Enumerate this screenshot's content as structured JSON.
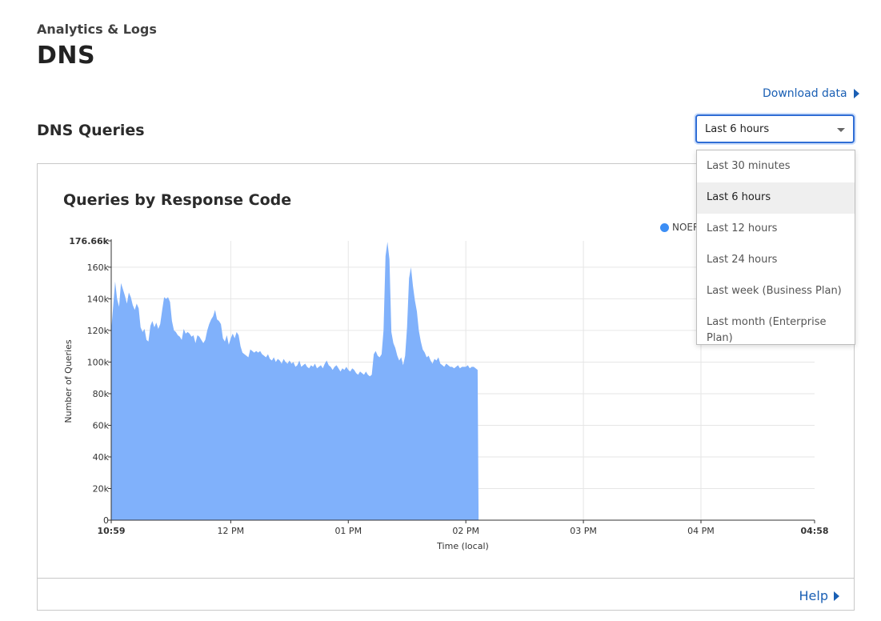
{
  "header": {
    "breadcrumb": "Analytics & Logs",
    "title": "DNS"
  },
  "download_label": "Download data",
  "section_title": "DNS Queries",
  "time_select": {
    "value": "Last 6 hours",
    "options": [
      "Last 30 minutes",
      "Last 6 hours",
      "Last 12 hours",
      "Last 24 hours",
      "Last week (Business Plan)",
      "Last month (Enterprise Plan)"
    ],
    "selected_index": 1
  },
  "chart_title": "Queries by Response Code",
  "legend_label": "NOER",
  "help_label": "Help",
  "colors": {
    "area_fill": "#80b1fb",
    "legend": "#3c8ef5",
    "link": "#1a5fb4",
    "focus": "#2f6dd5"
  },
  "chart_data": {
    "type": "area",
    "title": "Queries by Response Code",
    "xlabel": "Time (local)",
    "ylabel": "Number of Queries",
    "series_name": "NOER",
    "ylim": [
      0,
      176660
    ],
    "y_ticks": [
      "0",
      "20k",
      "40k",
      "60k",
      "80k",
      "100k",
      "120k",
      "140k",
      "160k",
      "176.66k"
    ],
    "x_ticks": [
      "10:59",
      "12 PM",
      "01 PM",
      "02 PM",
      "03 PM",
      "04 PM",
      "04:58"
    ],
    "x_tick_minutes": [
      0,
      61,
      121,
      181,
      241,
      301,
      359
    ],
    "grid": true,
    "legend_position": "top-right",
    "points": [
      [
        0,
        120000
      ],
      [
        1,
        135000
      ],
      [
        2,
        151000
      ],
      [
        3,
        140000
      ],
      [
        4,
        135000
      ],
      [
        5,
        150000
      ],
      [
        6,
        146000
      ],
      [
        7,
        142000
      ],
      [
        8,
        137000
      ],
      [
        9,
        144000
      ],
      [
        10,
        141000
      ],
      [
        11,
        136000
      ],
      [
        12,
        133000
      ],
      [
        13,
        137000
      ],
      [
        14,
        134000
      ],
      [
        15,
        122000
      ],
      [
        16,
        119000
      ],
      [
        17,
        121000
      ],
      [
        18,
        114000
      ],
      [
        19,
        113000
      ],
      [
        20,
        123000
      ],
      [
        21,
        126000
      ],
      [
        22,
        122000
      ],
      [
        23,
        125000
      ],
      [
        24,
        121000
      ],
      [
        25,
        124000
      ],
      [
        26,
        133000
      ],
      [
        27,
        141000
      ],
      [
        28,
        140000
      ],
      [
        29,
        141000
      ],
      [
        30,
        138000
      ],
      [
        31,
        126000
      ],
      [
        32,
        120000
      ],
      [
        33,
        119000
      ],
      [
        34,
        117000
      ],
      [
        35,
        116000
      ],
      [
        36,
        114000
      ],
      [
        37,
        121000
      ],
      [
        38,
        118000
      ],
      [
        39,
        119000
      ],
      [
        40,
        118000
      ],
      [
        41,
        116000
      ],
      [
        42,
        117000
      ],
      [
        43,
        112000
      ],
      [
        44,
        117000
      ],
      [
        45,
        116000
      ],
      [
        46,
        114000
      ],
      [
        47,
        112000
      ],
      [
        48,
        114000
      ],
      [
        49,
        120000
      ],
      [
        50,
        124000
      ],
      [
        51,
        127000
      ],
      [
        52,
        129000
      ],
      [
        53,
        133000
      ],
      [
        54,
        127000
      ],
      [
        55,
        126000
      ],
      [
        56,
        124000
      ],
      [
        57,
        115000
      ],
      [
        58,
        113000
      ],
      [
        59,
        117000
      ],
      [
        60,
        111000
      ],
      [
        61,
        115000
      ],
      [
        62,
        118000
      ],
      [
        63,
        115000
      ],
      [
        64,
        119000
      ],
      [
        65,
        117000
      ],
      [
        66,
        110000
      ],
      [
        67,
        106000
      ],
      [
        68,
        105000
      ],
      [
        69,
        104000
      ],
      [
        70,
        103000
      ],
      [
        71,
        108000
      ],
      [
        72,
        107000
      ],
      [
        73,
        106000
      ],
      [
        74,
        107000
      ],
      [
        75,
        106000
      ],
      [
        76,
        107000
      ],
      [
        77,
        105000
      ],
      [
        78,
        104000
      ],
      [
        79,
        103000
      ],
      [
        80,
        105000
      ],
      [
        81,
        102000
      ],
      [
        82,
        101000
      ],
      [
        83,
        103000
      ],
      [
        84,
        100000
      ],
      [
        85,
        102000
      ],
      [
        86,
        101000
      ],
      [
        87,
        99000
      ],
      [
        88,
        102000
      ],
      [
        89,
        100000
      ],
      [
        90,
        99000
      ],
      [
        91,
        101000
      ],
      [
        92,
        99000
      ],
      [
        93,
        100000
      ],
      [
        94,
        97000
      ],
      [
        95,
        98000
      ],
      [
        96,
        101000
      ],
      [
        97,
        97000
      ],
      [
        98,
        98000
      ],
      [
        99,
        99000
      ],
      [
        100,
        97000
      ],
      [
        101,
        96000
      ],
      [
        102,
        98000
      ],
      [
        103,
        97000
      ],
      [
        104,
        99000
      ],
      [
        105,
        96000
      ],
      [
        106,
        97000
      ],
      [
        107,
        98000
      ],
      [
        108,
        96000
      ],
      [
        109,
        99000
      ],
      [
        110,
        101000
      ],
      [
        111,
        98000
      ],
      [
        112,
        97000
      ],
      [
        113,
        95000
      ],
      [
        114,
        97000
      ],
      [
        115,
        98000
      ],
      [
        116,
        96000
      ],
      [
        117,
        94000
      ],
      [
        118,
        96000
      ],
      [
        119,
        95000
      ],
      [
        120,
        97000
      ],
      [
        121,
        95000
      ],
      [
        122,
        94000
      ],
      [
        123,
        96000
      ],
      [
        124,
        95000
      ],
      [
        125,
        93000
      ],
      [
        126,
        92000
      ],
      [
        127,
        94000
      ],
      [
        128,
        93000
      ],
      [
        129,
        92000
      ],
      [
        130,
        94000
      ],
      [
        131,
        92000
      ],
      [
        132,
        91000
      ],
      [
        133,
        92000
      ],
      [
        134,
        105000
      ],
      [
        135,
        107000
      ],
      [
        136,
        104000
      ],
      [
        137,
        103000
      ],
      [
        138,
        105000
      ],
      [
        139,
        120000
      ],
      [
        140,
        167000
      ],
      [
        141,
        176000
      ],
      [
        142,
        165000
      ],
      [
        143,
        119000
      ],
      [
        144,
        112000
      ],
      [
        145,
        109000
      ],
      [
        146,
        104000
      ],
      [
        147,
        101000
      ],
      [
        148,
        103000
      ],
      [
        149,
        98000
      ],
      [
        150,
        104000
      ],
      [
        151,
        122000
      ],
      [
        152,
        153000
      ],
      [
        153,
        160000
      ],
      [
        154,
        148000
      ],
      [
        155,
        139000
      ],
      [
        156,
        132000
      ],
      [
        157,
        120000
      ],
      [
        158,
        113000
      ],
      [
        159,
        108000
      ],
      [
        160,
        106000
      ],
      [
        161,
        103000
      ],
      [
        162,
        104000
      ],
      [
        163,
        101000
      ],
      [
        164,
        99000
      ],
      [
        165,
        102000
      ],
      [
        166,
        101000
      ],
      [
        167,
        103000
      ],
      [
        168,
        99000
      ],
      [
        169,
        98000
      ],
      [
        170,
        97000
      ],
      [
        171,
        99000
      ],
      [
        172,
        98000
      ],
      [
        173,
        97000
      ],
      [
        174,
        97000
      ],
      [
        175,
        96000
      ],
      [
        176,
        97000
      ],
      [
        177,
        98000
      ],
      [
        178,
        96000
      ],
      [
        179,
        97000
      ],
      [
        180,
        97000
      ],
      [
        181,
        97000
      ],
      [
        182,
        98000
      ],
      [
        183,
        96000
      ],
      [
        184,
        97000
      ],
      [
        185,
        97000
      ],
      [
        186,
        96000
      ],
      [
        187,
        95000
      ],
      [
        187.5,
        0
      ]
    ]
  }
}
